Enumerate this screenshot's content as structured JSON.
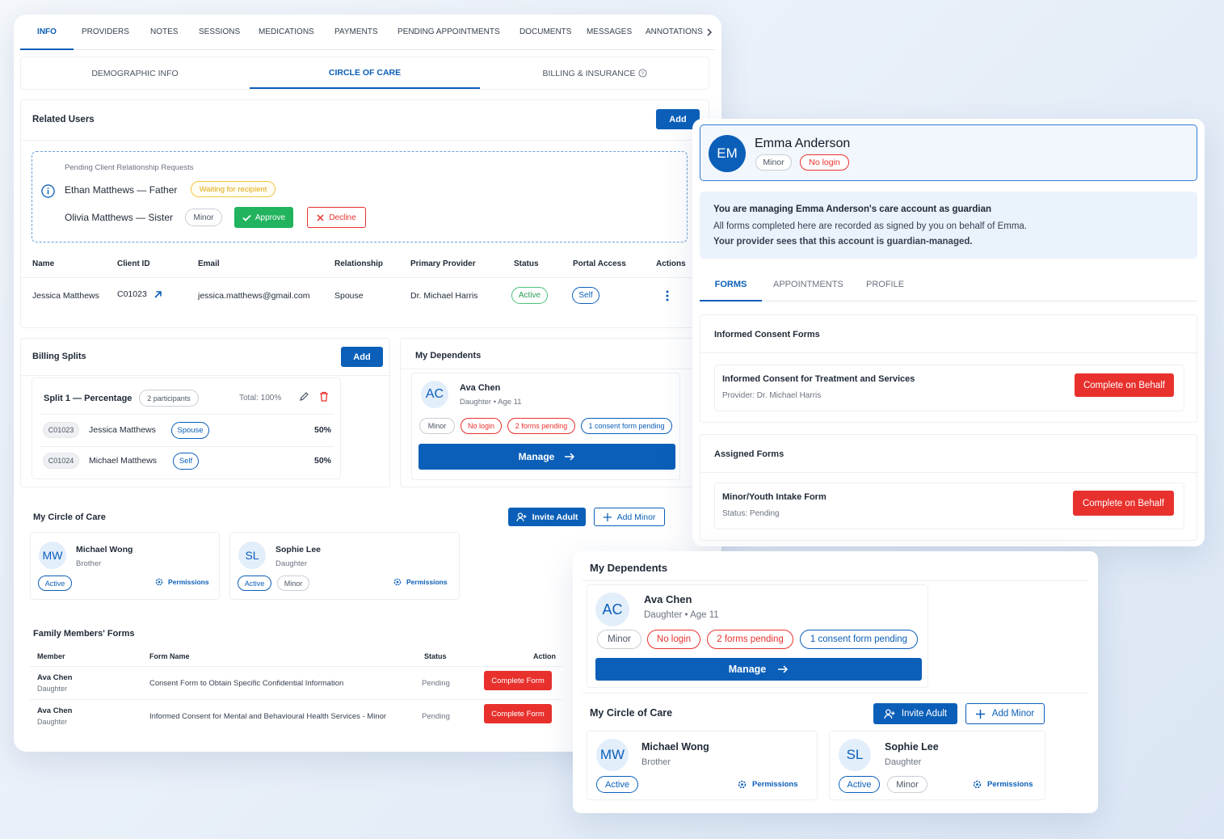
{
  "main_tabs": [
    "INFO",
    "PROVIDERS",
    "NOTES",
    "SESSIONS",
    "MEDICATIONS",
    "PAYMENTS",
    "PENDING APPOINTMENTS",
    "DOCUMENTS",
    "MESSAGES",
    "ANNOTATIONS"
  ],
  "sub_tabs": [
    "DEMOGRAPHIC INFO",
    "CIRCLE OF CARE",
    "BILLING & INSURANCE"
  ],
  "related_users": {
    "title": "Related Users",
    "add": "Add",
    "pending_title": "Pending Client Relationship Requests",
    "req1": "Ethan Matthews — Father",
    "req1_status": "Waiting for recipient",
    "req2": "Olivia Matthews — Sister",
    "req2_badge": "Minor",
    "approve": "Approve",
    "decline": "Decline",
    "headers": [
      "Name",
      "Client ID",
      "Email",
      "Relationship",
      "Primary Provider",
      "Status",
      "Portal Access",
      "Actions"
    ],
    "row": {
      "name": "Jessica Matthews",
      "client_id": "C01023",
      "email": "jessica.matthews@gmail.com",
      "relationship": "Spouse",
      "provider": "Dr. Michael Harris",
      "status": "Active",
      "portal": "Self"
    }
  },
  "billing": {
    "title": "Billing Splits",
    "add": "Add",
    "split_title": "Split 1 — Percentage",
    "participants": "2 participants",
    "total": "Total: 100%",
    "rows": [
      {
        "id": "C01023",
        "name": "Jessica Matthews",
        "rel": "Spouse",
        "pct": "50%"
      },
      {
        "id": "C01024",
        "name": "Michael Matthews",
        "rel": "Self",
        "pct": "50%"
      }
    ]
  },
  "dependents_small": {
    "title": "My Dependents",
    "initials": "AC",
    "name": "Ava Chen",
    "sub": "Daughter • Age 11",
    "badges": [
      "Minor",
      "No login",
      "2 forms pending",
      "1 consent form pending"
    ],
    "manage": "Manage"
  },
  "circle_small": {
    "title": "My Circle of Care",
    "invite": "Invite Adult",
    "add_minor": "Add Minor",
    "members": [
      {
        "initials": "MW",
        "name": "Michael Wong",
        "rel": "Brother",
        "badges": [
          "Active"
        ],
        "perm": "Permissions"
      },
      {
        "initials": "SL",
        "name": "Sophie Lee",
        "rel": "Daughter",
        "badges": [
          "Active",
          "Minor"
        ],
        "perm": "Permissions"
      }
    ]
  },
  "family_forms": {
    "title": "Family Members' Forms",
    "headers": [
      "Member",
      "Form Name",
      "Status",
      "Action"
    ],
    "rows": [
      {
        "member": "Ava Chen",
        "rel": "Daughter",
        "form": "Consent Form to Obtain Specific Confidential Information",
        "status": "Pending",
        "action": "Complete Form"
      },
      {
        "member": "Ava Chen",
        "rel": "Daughter",
        "form": "Informed Consent for Mental and Behavioural Health Services - Minor",
        "status": "Pending",
        "action": "Complete Form"
      }
    ]
  },
  "guardian": {
    "initials": "EM",
    "name": "Emma Anderson",
    "badges": [
      "Minor",
      "No login"
    ],
    "notice_title": "You are managing Emma Anderson's care account as guardian",
    "notice_1": "All forms completed here are recorded as signed by you on behalf of Emma.",
    "notice_2": "Your provider sees that this account is guardian-managed.",
    "tabs": [
      "FORMS",
      "APPOINTMENTS",
      "PROFILE"
    ],
    "consent_title": "Informed Consent Forms",
    "consent_form": "Informed Consent for Treatment and Services",
    "consent_provider": "Provider: Dr. Michael Harris",
    "assigned_title": "Assigned Forms",
    "assigned_form": "Minor/Youth Intake Form",
    "assigned_status": "Status: Pending",
    "action": "Complete on Behalf"
  },
  "dependents_large": {
    "title": "My Dependents",
    "initials": "AC",
    "name": "Ava Chen",
    "sub": "Daughter • Age 11",
    "badges": [
      "Minor",
      "No login",
      "2 forms pending",
      "1 consent form pending"
    ],
    "manage": "Manage",
    "circle_title": "My Circle of Care",
    "invite": "Invite Adult",
    "add_minor": "Add Minor",
    "members": [
      {
        "initials": "MW",
        "name": "Michael Wong",
        "rel": "Brother",
        "badges": [
          "Active"
        ],
        "perm": "Permissions"
      },
      {
        "initials": "SL",
        "name": "Sophie Lee",
        "rel": "Daughter",
        "badges": [
          "Active",
          "Minor"
        ],
        "perm": "Permissions"
      }
    ]
  },
  "colors": {
    "primary": "#0b5fb8",
    "danger": "#e8312d",
    "success": "#22b35e",
    "warning": "#f3c43c"
  }
}
